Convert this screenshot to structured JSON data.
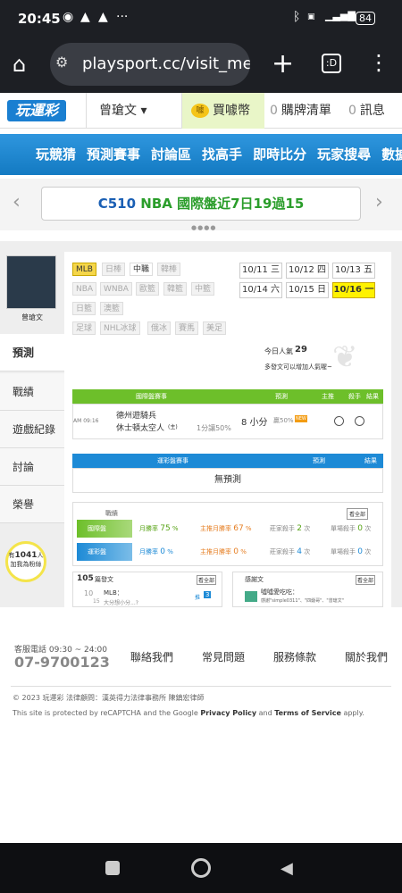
{
  "status_bar": {
    "time": "20:45",
    "battery": "84"
  },
  "browser": {
    "url": "playsport.cc/visit_mer",
    "tabs_label": ":D"
  },
  "site_header": {
    "logo": "玩運彩",
    "user_name": "曾瑲文 ▾",
    "coin_label": "買噱幣",
    "coin_icon": "噱",
    "cart_count": "0",
    "cart_label": "購牌清單",
    "msg_count": "0",
    "msg_label": "訊息"
  },
  "nav": {
    "items": [
      "玩競猜",
      "預測賽事",
      "討論區",
      "找高手",
      "即時比分",
      "玩家搜尋",
      "數據"
    ]
  },
  "banner": {
    "code": "C510",
    "league": "NBA",
    "text": "國際盤近7日19過15",
    "colors": {
      "code": "#1a5fb4",
      "league": "#2a9d2a",
      "text": "#2a9d2a"
    }
  },
  "sidebar": {
    "avatar_name": "曾瑲文",
    "items": [
      "預測",
      "戰績",
      "遊戲紀錄",
      "討論",
      "榮譽"
    ],
    "active": "預測",
    "bulb_prefix": "有",
    "bulb_count": "1041",
    "bulb_suffix": "人",
    "bulb_text": "加我為粉絲"
  },
  "leagues": {
    "row1": [
      "MLB",
      "日棒",
      "中職",
      "韓棒"
    ],
    "row2": [
      "NBA",
      "WNBA",
      "歐籃",
      "韓籃",
      "中籃"
    ],
    "row3": [
      "日籃",
      "澳籃"
    ],
    "row4": [
      "足球",
      "NHL冰球",
      "俄冰",
      "賽馬",
      "美足"
    ],
    "selected": "MLB"
  },
  "dates": {
    "row1": [
      "10/11 三",
      "10/12 四",
      "10/13 五"
    ],
    "row2": [
      "10/14 六",
      "10/15 日",
      "10/16 一"
    ],
    "selected": "10/16 一"
  },
  "stats": {
    "visit_label": "今日人氣",
    "visit_count": "29",
    "encourage": "多發文可以增加人氣喔~"
  },
  "intl_table": {
    "header": [
      "國際盤賽事",
      "預測",
      "主推",
      "殺手",
      "結果"
    ],
    "row": {
      "time": "AM 09:16",
      "team1": "德州遊騎兵",
      "team2": "休士頓太空人",
      "team2_tag": "(主)",
      "spread": "1分讓50%",
      "pick": "8 小分",
      "pick_sub": "贏50%",
      "pick_badge": "NEW"
    }
  },
  "taiwan_table": {
    "header": [
      "運彩盤賽事",
      "預測",
      "結果"
    ],
    "empty": "無預測"
  },
  "record": {
    "title": "戰績",
    "view_all": "看全部",
    "rows": [
      {
        "label": "國際盤",
        "month": "月勝率",
        "month_val": "75",
        "month_unit": "%",
        "main": "主推月勝率",
        "main_val": "67",
        "main_unit": "%",
        "kill": "莊家殺手",
        "kill_val": "2",
        "kill_unit": "次",
        "single": "單場殺手",
        "single_val": "0",
        "single_unit": "次"
      },
      {
        "label": "運彩盤",
        "month": "月勝率",
        "month_val": "0",
        "month_unit": "%",
        "main": "主推月勝率",
        "main_val": "0",
        "main_unit": "%",
        "kill": "莊家殺手",
        "kill_val": "4",
        "kill_unit": "次",
        "single": "單場殺手",
        "single_val": "0",
        "single_unit": "次"
      }
    ]
  },
  "posts": {
    "count": "105",
    "label": "篇發文",
    "view_all": "看全部",
    "item_num": "10",
    "item_date": "15",
    "item_title": "MLB：",
    "item_sub": "大分想小分...?",
    "item_tag": "推",
    "item_count": "3"
  },
  "thanks": {
    "label": "感謝文",
    "view_all": "看全部",
    "item_title": "噓噓愛吃吃：",
    "item_text": "感謝\"simple0311\"、\"四爺哥\"、\"曾瑲文\""
  },
  "footer": {
    "phone_label": "客服電話 09:30 ~ 24:00",
    "phone": "07-9700123",
    "links": [
      "聯絡我們",
      "常見問題",
      "服務條款",
      "關於我們"
    ],
    "copyright": "© 2023 玩運彩 法律顧問：漢英得力法律事務所 陳鎮宏律師",
    "recaptcha_pre": "This site is protected by reCAPTCHA and the Google ",
    "privacy": "Privacy Policy",
    "and": " and ",
    "terms": "Terms of Service",
    "apply": " apply."
  }
}
